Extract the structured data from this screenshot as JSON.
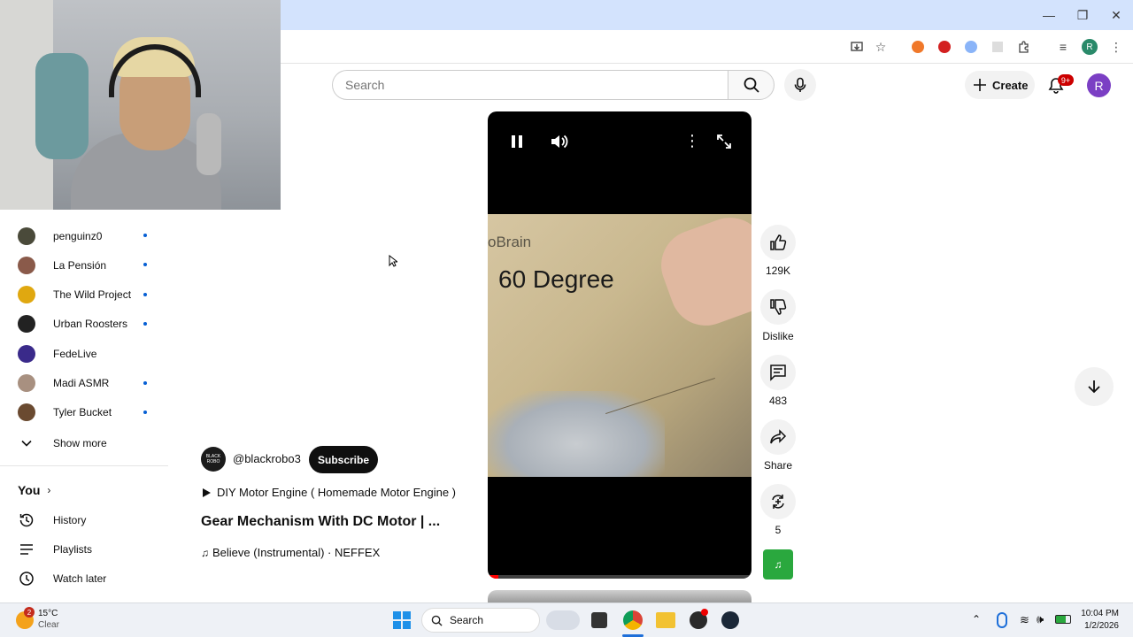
{
  "header": {
    "search_placeholder": "Search",
    "create_label": "Create",
    "notification_count": "9+",
    "avatar_letter": "R"
  },
  "browser": {
    "profile_letter": "R"
  },
  "sidebar": {
    "subscriptions": [
      {
        "name": "penguinz0",
        "color": "#4a4a3a",
        "new": true
      },
      {
        "name": "La Pensión",
        "color": "#8a5a4a",
        "new": true
      },
      {
        "name": "The Wild Project",
        "color": "#e0a810",
        "new": true
      },
      {
        "name": "Urban Roosters",
        "color": "#222222",
        "new": true
      },
      {
        "name": "FedeLive",
        "color": "#3a2a8a",
        "new": false
      },
      {
        "name": "Madi ASMR",
        "color": "#a89080",
        "new": true
      },
      {
        "name": "Tyler Bucket",
        "color": "#6a4a30",
        "new": true
      }
    ],
    "show_more": "Show more",
    "you_label": "You",
    "you_items": [
      {
        "label": "History",
        "icon": "history-icon"
      },
      {
        "label": "Playlists",
        "icon": "playlists-icon"
      },
      {
        "label": "Watch later",
        "icon": "watch-later-icon"
      }
    ]
  },
  "video": {
    "overlay_text_brand": "oBrain",
    "overlay_text_main": "60 Degree",
    "channel_name": "@blackrobo3",
    "channel_avatar_text": "BLACK ROBO",
    "subscribe_label": "Subscribe",
    "playlist_link": "DIY Motor Engine ( Homemade Motor Engine )",
    "title": "Gear Mechanism With DC Motor | ...",
    "music": "Believe (Instrumental) · NEFFEX",
    "progress": 0.04
  },
  "actions": {
    "likes": "129K",
    "dislike_label": "Dislike",
    "comments": "483",
    "share_label": "Share",
    "remix_count": "5"
  },
  "taskbar": {
    "weather_temp": "15°C",
    "weather_cond": "Clear",
    "weather_badge": "2",
    "search_label": "Search",
    "time": "10:04 PM",
    "date": "1/2/2026"
  }
}
